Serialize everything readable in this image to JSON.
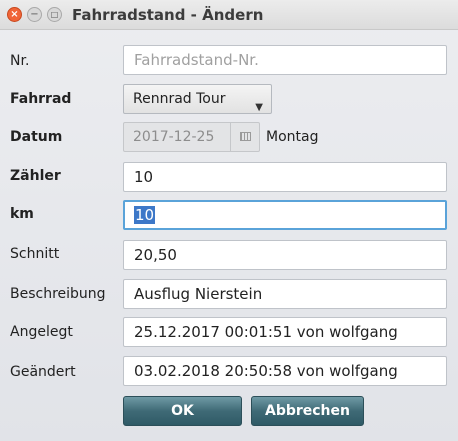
{
  "window": {
    "title": "Fahrradstand - Ändern"
  },
  "form": {
    "nr": {
      "label": "Nr.",
      "placeholder": "Fahrradstand-Nr."
    },
    "fahrrad": {
      "label": "Fahrrad",
      "value": "Rennrad Tour"
    },
    "datum": {
      "label": "Datum",
      "value": "2017-12-25",
      "weekday": "Montag"
    },
    "zaehler": {
      "label": "Zähler",
      "value": "10"
    },
    "km": {
      "label": "km",
      "value": "10"
    },
    "schnitt": {
      "label": "Schnitt",
      "value": "20,50"
    },
    "beschreibung": {
      "label": "Beschreibung",
      "value": "Ausflug Nierstein"
    },
    "angelegt": {
      "label": "Angelegt",
      "value": "25.12.2017 00:01:51 von wolfgang"
    },
    "geaendert": {
      "label": "Geändert",
      "value": "03.02.2018 20:50:58 von wolfgang"
    }
  },
  "buttons": {
    "ok": "OK",
    "cancel": "Abbrechen"
  },
  "icons": {
    "close": "close-icon",
    "minimize": "minimize-icon",
    "maximize": "maximize-icon",
    "dropdown": "chevron-down-icon",
    "calendar": "calendar-icon"
  },
  "colors": {
    "button": "#3f6a76",
    "close": "#f06437",
    "focus": "#5aa3d9",
    "selection": "#3d78c8"
  }
}
